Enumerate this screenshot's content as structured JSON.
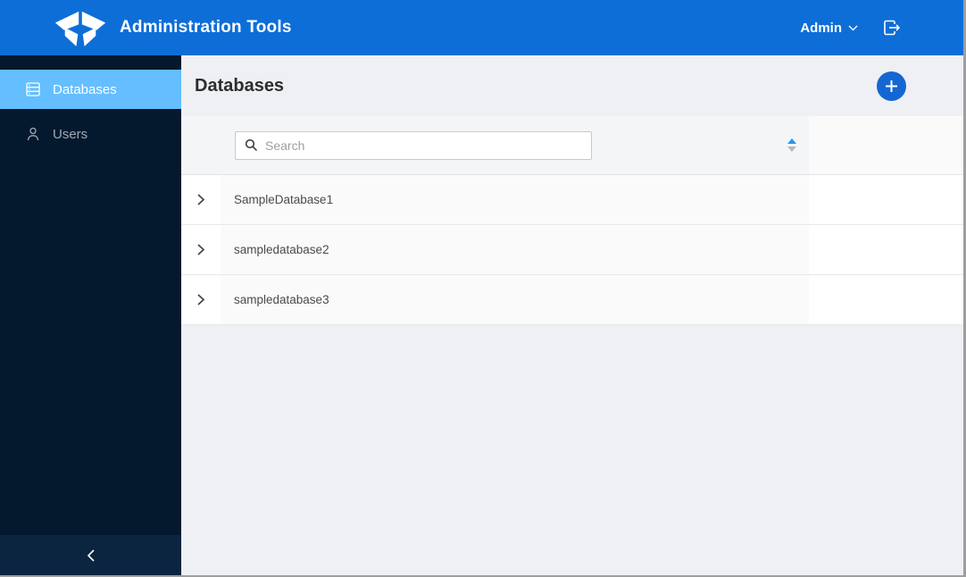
{
  "app": {
    "title": "Administration Tools"
  },
  "header": {
    "user_menu_label": "Admin",
    "icons": {
      "logo": "brand-logo",
      "user_chevron": "chevron-down-icon",
      "logout": "logout-icon"
    }
  },
  "sidebar": {
    "items": [
      {
        "label": "Databases",
        "icon": "databases-icon",
        "selected": true
      },
      {
        "label": "Users",
        "icon": "users-icon",
        "selected": false
      }
    ],
    "collapse_icon": "chevron-left-icon"
  },
  "main": {
    "page_title": "Databases",
    "add_button_icon": "plus-icon",
    "search": {
      "placeholder": "Search",
      "icon": "search-icon"
    },
    "sort": {
      "direction": "ascending",
      "icon": "sort-arrows-icon"
    },
    "rows": [
      {
        "name": "SampleDatabase1",
        "expand_icon": "chevron-right-icon"
      },
      {
        "name": "sampledatabase2",
        "expand_icon": "chevron-right-icon"
      },
      {
        "name": "sampledatabase3",
        "expand_icon": "chevron-right-icon"
      }
    ]
  },
  "colors": {
    "header_blue": "#0d6ed8",
    "sidebar_navy": "#05192e",
    "sidebar_footer_navy": "#0b2440",
    "selected_item_blue": "#64beff",
    "add_button_blue": "#1467d2",
    "sort_active_blue": "#2196f3",
    "main_background": "#eef0f4",
    "row_background": "#fafafa"
  }
}
